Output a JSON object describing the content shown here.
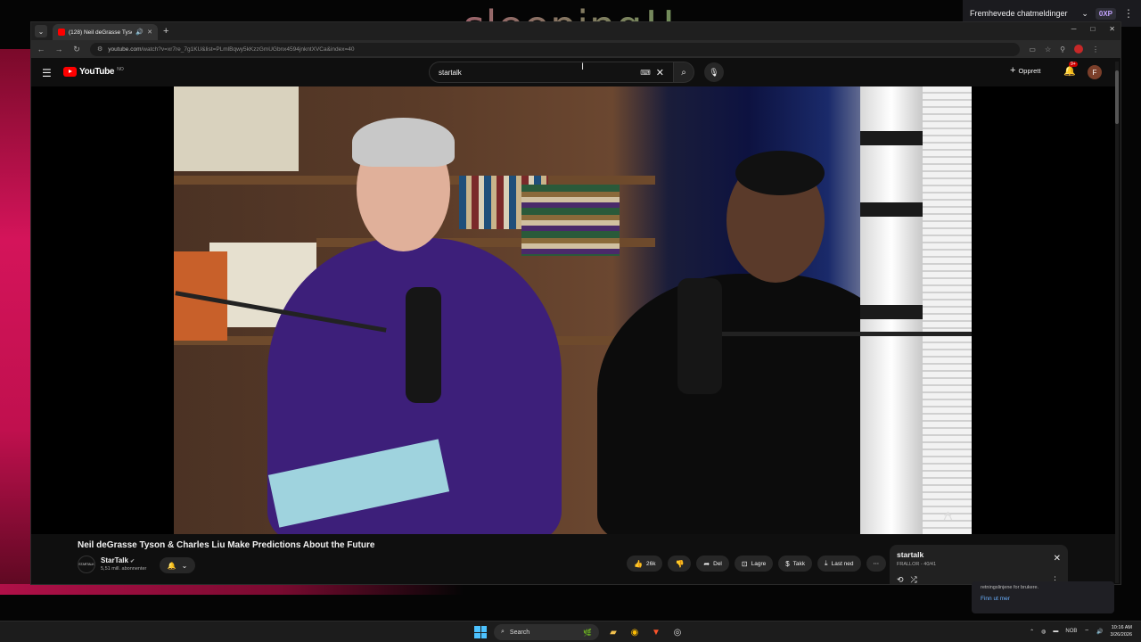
{
  "overlay": {
    "text": "sleeping!!"
  },
  "chat_panel": {
    "title": "Fremhevede chatmeldinger",
    "xp_badge": "0XP",
    "menu_icon": "kebab-icon"
  },
  "browser": {
    "tab": {
      "title": "(128) Neil deGrasse Tyson &",
      "favicon": "youtube-icon"
    },
    "url": {
      "host": "youtube.com",
      "path": "/watch?v=xr7re_7g1KU&list=PLmlBqwy5kKzzGmUGbnx4594jnkntXVCa&index=40"
    }
  },
  "youtube": {
    "logo_text": "YouTube",
    "logo_suffix": "NO",
    "search": {
      "query": "startalk"
    },
    "create_label": "Opprett",
    "notification_count": "9+",
    "avatar_letter": "F"
  },
  "video": {
    "title": "Neil deGrasse Tyson & Charles Liu Make Predictions About the Future",
    "channel": {
      "icon_text": "STARTALK",
      "name": "StarTalk",
      "subscribers": "5,51 mill. abonnenter"
    },
    "actions": {
      "likes": "26k",
      "share": "Del",
      "save": "Lagre",
      "thanks": "Takk",
      "download": "Last ned"
    }
  },
  "playlist": {
    "title": "startalk",
    "meta": "FRALLOR - 40/41"
  },
  "notification": {
    "text": "retningslinjene for brukere.",
    "link": "Finn ut mer"
  },
  "taskbar": {
    "search_placeholder": "Search",
    "tray_lang": "NOB",
    "time": "10:16 AM",
    "date": "3/26/2026"
  },
  "colors": {
    "youtube_red": "#ff0000",
    "accent_blue": "#4cc2ff",
    "overlay_pink": "#c0407a",
    "overlay_green": "#4ab04a"
  }
}
